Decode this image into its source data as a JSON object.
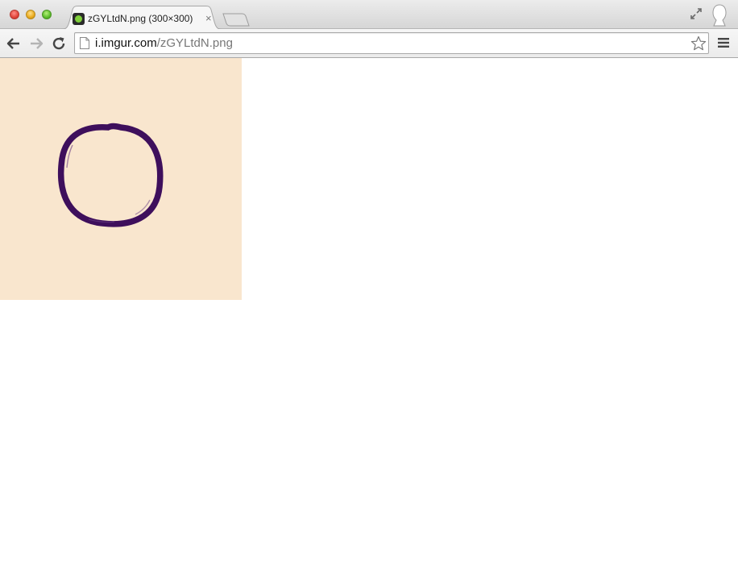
{
  "tab": {
    "title": "zGYLtdN.png (300×300)",
    "close_label": "×",
    "favicon": "imgur-favicon-icon"
  },
  "address_bar": {
    "host": "i.imgur.com",
    "path": "/zGYLtdN.png"
  },
  "icons": {
    "back": "arrow-left-icon",
    "forward": "arrow-right-icon",
    "reload": "reload-icon",
    "bookmark": "star-icon",
    "menu": "hamburger-menu-icon",
    "fullscreen": "fullscreen-icon",
    "profile": "profile-avatar-icon"
  },
  "colors": {
    "image_background": "#f9e6ce",
    "circle_stroke": "#3e0f5c"
  },
  "image": {
    "content": "hand-drawn purple circle on beige"
  }
}
